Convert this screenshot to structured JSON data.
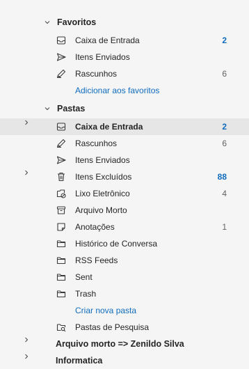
{
  "favorites": {
    "title": "Favoritos",
    "items": [
      {
        "label": "Caixa de Entrada",
        "count": "2",
        "icon": "inbox-icon"
      },
      {
        "label": "Itens Enviados",
        "count": "",
        "icon": "send-icon"
      },
      {
        "label": "Rascunhos",
        "count": "6",
        "icon": "drafts-icon"
      }
    ],
    "add_link": "Adicionar aos favoritos"
  },
  "folders": {
    "title": "Pastas",
    "items": [
      {
        "label": "Caixa de Entrada",
        "count": "2",
        "icon": "inbox-icon"
      },
      {
        "label": "Rascunhos",
        "count": "6",
        "icon": "drafts-icon"
      },
      {
        "label": "Itens Enviados",
        "count": "",
        "icon": "send-icon"
      },
      {
        "label": "Itens Excluídos",
        "count": "88",
        "icon": "trash-icon"
      },
      {
        "label": "Lixo Eletrônico",
        "count": "4",
        "icon": "junk-icon"
      },
      {
        "label": "Arquivo Morto",
        "count": "",
        "icon": "archive-icon"
      },
      {
        "label": "Anotações",
        "count": "1",
        "icon": "note-icon"
      },
      {
        "label": "Histórico de Conversa",
        "count": "",
        "icon": "folder-icon"
      },
      {
        "label": "RSS Feeds",
        "count": "",
        "icon": "folder-icon"
      },
      {
        "label": "Sent",
        "count": "",
        "icon": "folder-icon"
      },
      {
        "label": "Trash",
        "count": "",
        "icon": "folder-icon"
      }
    ],
    "new_folder_link": "Criar nova pasta",
    "search_folders": {
      "label": "Pastas de Pesquisa",
      "icon": "search-folder-icon"
    }
  },
  "accounts": [
    {
      "label": "Arquivo morto => Zenildo Silva"
    },
    {
      "label": "Informatica"
    }
  ],
  "colors": {
    "accent": "#0f6cbd",
    "selected_bg": "#e6e6e6",
    "background": "#f5f5f5"
  }
}
